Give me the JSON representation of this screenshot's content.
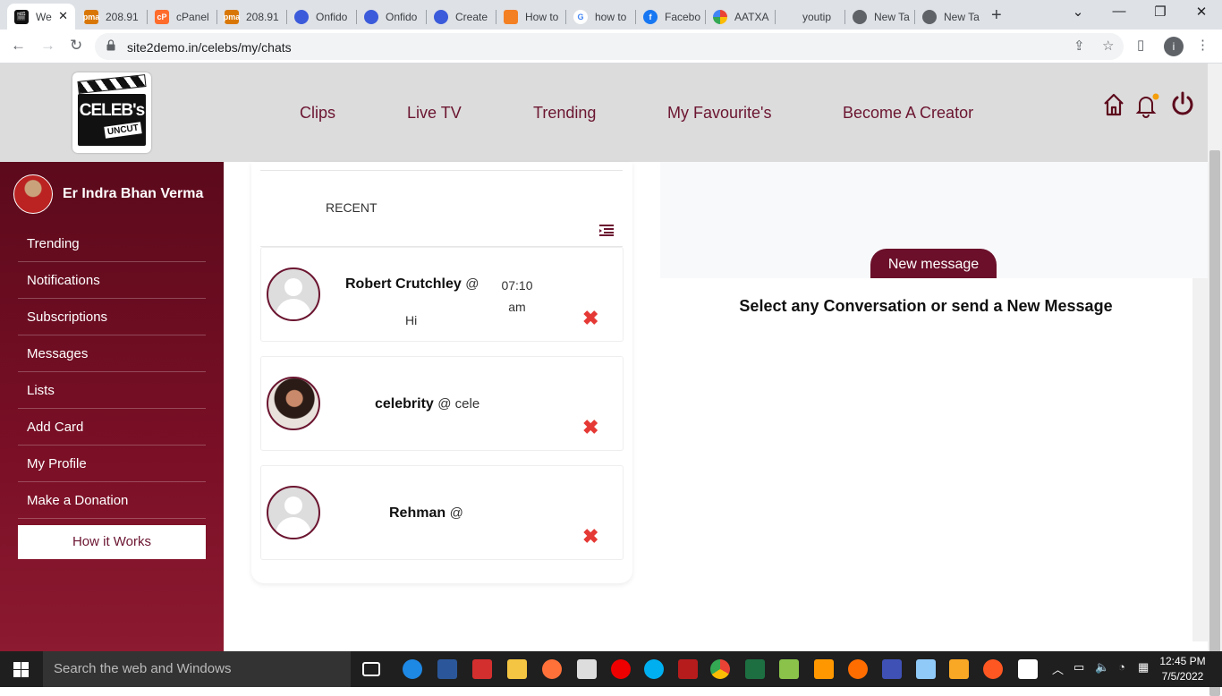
{
  "browser": {
    "tabs": [
      {
        "label": "We",
        "active": true,
        "fav_color": "#111"
      },
      {
        "label": "208.91",
        "fav_color": "#d97706"
      },
      {
        "label": "cPanel",
        "fav_color": "#ff6c2c"
      },
      {
        "label": "208.91",
        "fav_color": "#d97706"
      },
      {
        "label": "Onfido",
        "fav_color": "#3b5bdb"
      },
      {
        "label": "Onfido",
        "fav_color": "#3b5bdb"
      },
      {
        "label": "Create",
        "fav_color": "#3b5bdb"
      },
      {
        "label": "How to",
        "fav_color": "#f48024"
      },
      {
        "label": "how to",
        "fav_color": "#4285f4"
      },
      {
        "label": "Facebo",
        "fav_color": "#1877f2"
      },
      {
        "label": "AATXA",
        "fav_color": "#34a853"
      },
      {
        "label": "youtip",
        "fav_color": "#dee1e6"
      },
      {
        "label": "New Ta",
        "fav_color": "#5f6368"
      },
      {
        "label": "New Ta",
        "fav_color": "#5f6368"
      }
    ],
    "url": "site2demo.in/celebs/my/chats",
    "profile_initial": "i"
  },
  "header": {
    "logo_top": "CELEB's",
    "logo_sub": "UNCUT",
    "nav": [
      "Clips",
      "Live TV",
      "Trending",
      "My Favourite's",
      "Become A Creator"
    ]
  },
  "sidebar": {
    "user_name": "Er Indra Bhan Verma",
    "items": [
      "Trending",
      "Notifications",
      "Subscriptions",
      "Messages",
      "Lists",
      "Add Card",
      "My Profile",
      "Make a Donation"
    ],
    "how_it_works": "How it Works"
  },
  "chats": {
    "recent_label": "RECENT",
    "list": [
      {
        "name": "Robert Crutchley",
        "handle": "@",
        "time_hm": "07:10",
        "time_ampm": "am",
        "message": "Hi",
        "avatar": "placeholder"
      },
      {
        "name": "celebrity",
        "handle": "@ cele",
        "time_hm": "",
        "time_ampm": "",
        "message": "",
        "avatar": "photo"
      },
      {
        "name": "Rehman",
        "handle": "@",
        "time_hm": "",
        "time_ampm": "",
        "message": "",
        "avatar": "placeholder"
      }
    ],
    "delete_symbol": "✖"
  },
  "conversation": {
    "new_message_label": "New message",
    "hint": "Select any Conversation or send a New Message"
  },
  "taskbar": {
    "search_placeholder": "Search the web and Windows",
    "time": "12:45 PM",
    "date": "7/5/2022"
  },
  "colors": {
    "brand": "#6b1530",
    "delete": "#e53935"
  }
}
